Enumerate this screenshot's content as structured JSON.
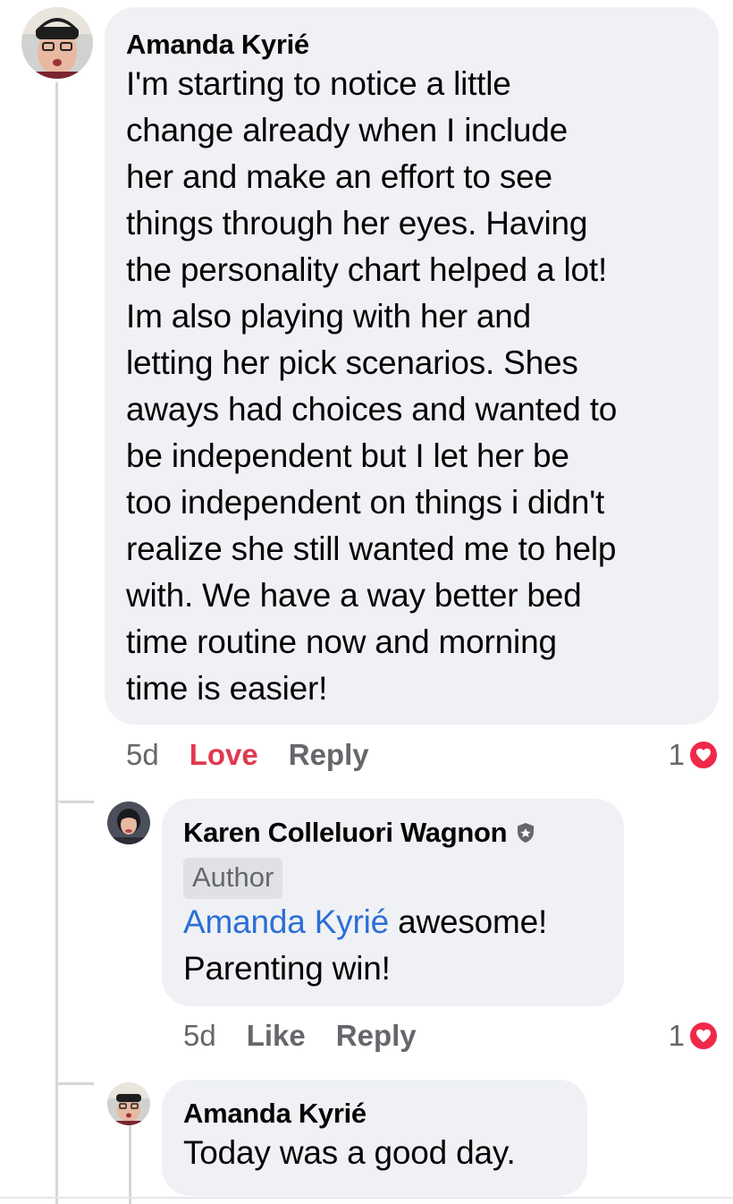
{
  "comments": [
    {
      "author": "Amanda Kyrié",
      "text_lines": [
        "I'm starting to notice a little",
        "change already when I include",
        "her and make an effort to see",
        "things through her eyes. Having",
        "the personality chart helped a lot!",
        "Im also playing with her and",
        "letting her pick scenarios. Shes",
        "aways had choices and wanted to",
        "be independent but I let her be",
        "too independent on things i didn't",
        "realize she still wanted me to help",
        "with. We have a way better bed",
        "time routine now and morning",
        "time is easier!"
      ],
      "time": "5d",
      "reaction_button": "Love",
      "reply_button": "Reply",
      "reaction_count": "1"
    },
    {
      "author": "Karen Colleluori Wagnon",
      "badge": "Author",
      "mention": "Amanda Kyrié",
      "text_line1_rest": " awesome!",
      "text_line2": "Parenting win!",
      "time": "5d",
      "reaction_button": "Like",
      "reply_button": "Reply",
      "reaction_count": "1"
    },
    {
      "author": "Amanda Kyrié",
      "text": "Today was a good day."
    }
  ],
  "icons": {
    "reaction": "heart-icon",
    "verified": "shield-badge-icon"
  },
  "colors": {
    "bubble": "#eff1f4",
    "love": "#e0394f",
    "mention": "#2b6fd6",
    "heart": "#f0284a"
  }
}
